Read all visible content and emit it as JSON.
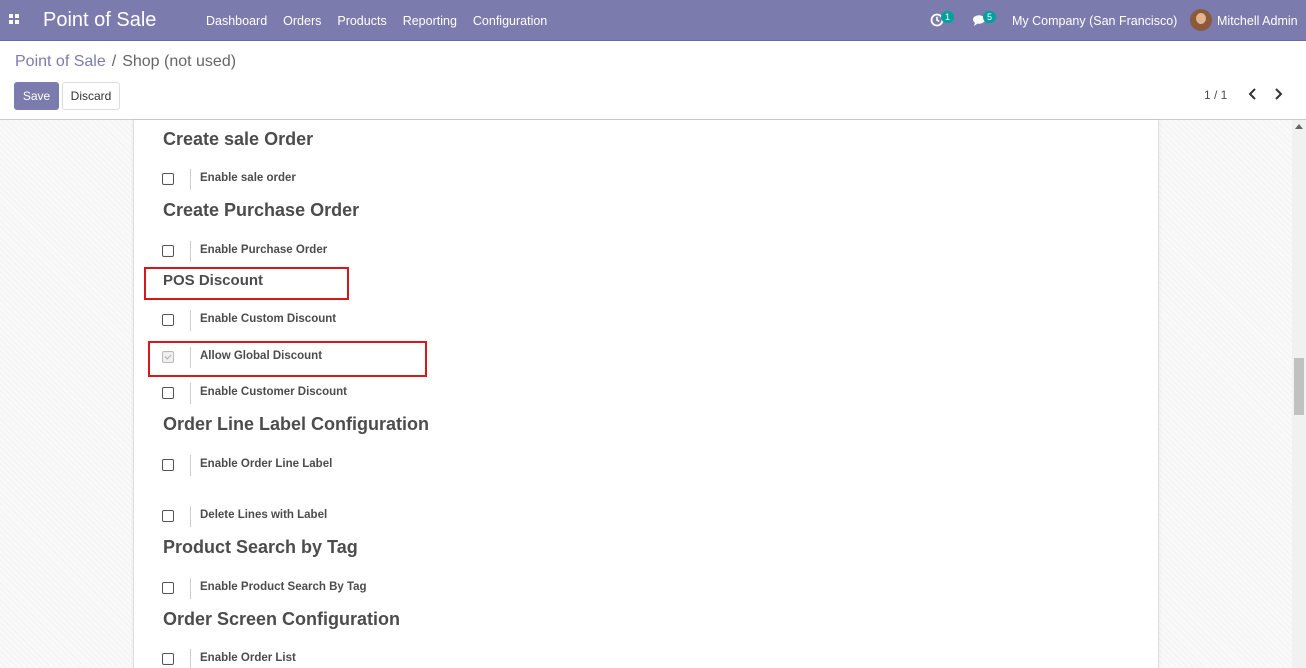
{
  "navbar": {
    "brand": "Point of Sale",
    "menu": [
      "Dashboard",
      "Orders",
      "Products",
      "Reporting",
      "Configuration"
    ],
    "activity_count": "1",
    "message_count": "5",
    "company": "My Company (San Francisco)",
    "user": "Mitchell Admin"
  },
  "breadcrumb": {
    "parent": "Point of Sale",
    "separator": "/",
    "current": "Shop (not used)"
  },
  "buttons": {
    "save": "Save",
    "discard": "Discard"
  },
  "pager": {
    "value": "1 / 1"
  },
  "sections": {
    "sale_order": {
      "title": "Create sale Order",
      "settings": [
        {
          "label": "Enable sale order",
          "checked": false
        }
      ]
    },
    "purchase_order": {
      "title": "Create Purchase Order",
      "settings": [
        {
          "label": "Enable Purchase Order",
          "checked": false
        }
      ]
    },
    "pos_discount": {
      "title": "POS Discount",
      "settings": [
        {
          "label": "Enable Custom Discount",
          "checked": false
        },
        {
          "label": "Allow Global Discount",
          "checked": true
        },
        {
          "label": "Enable Customer Discount",
          "checked": false
        }
      ]
    },
    "order_line_label": {
      "title": "Order Line Label Configuration",
      "settings": [
        {
          "label": "Enable Order Line Label",
          "checked": false
        },
        {
          "label": "Delete Lines with Label",
          "checked": false
        }
      ]
    },
    "product_search": {
      "title": "Product Search by Tag",
      "settings": [
        {
          "label": "Enable Product Search By Tag",
          "checked": false
        }
      ]
    },
    "order_screen": {
      "title": "Order Screen Configuration",
      "settings": [
        {
          "label": "Enable Order List",
          "checked": false
        }
      ]
    }
  },
  "colors": {
    "navbar": "#7c7bad",
    "primary": "#7c7bad",
    "badge": "#00a09d",
    "highlight": "#d9161b"
  }
}
